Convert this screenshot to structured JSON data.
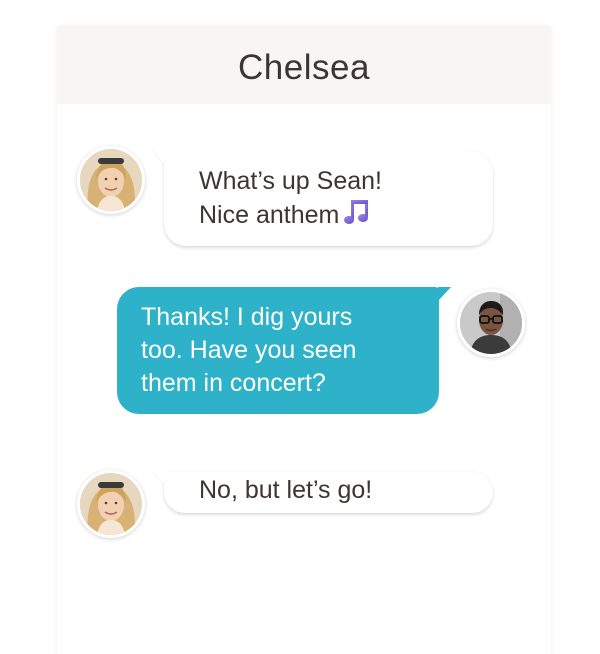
{
  "header": {
    "title": "Chelsea"
  },
  "messages": [
    {
      "sender": "incoming",
      "lines": [
        "What’s up Sean!",
        "Nice anthem"
      ],
      "emoji": "musical-notes-icon"
    },
    {
      "sender": "outgoing",
      "lines": [
        "Thanks! I dig yours",
        "too. Have you seen",
        "them in concert?"
      ]
    },
    {
      "sender": "incoming",
      "lines": [
        "No, but let’s go!"
      ]
    }
  ],
  "colors": {
    "header_bg": "#f8f6f3",
    "header_text": "#3e3532",
    "outgoing_bubble": "#2eb2c9",
    "incoming_bubble": "#ffffff",
    "emoji": "#7b62d1"
  }
}
